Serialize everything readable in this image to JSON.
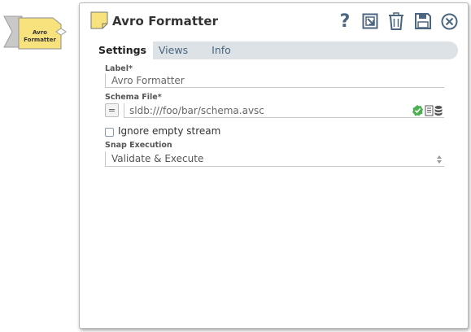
{
  "canvas": {
    "snap_label_line1": "Avro",
    "snap_label_line2": "Formatter",
    "snap_color": "#f7e27d"
  },
  "dialog": {
    "title": "Avro Formatter",
    "toolbar": {
      "help_icon": "question-mark-icon",
      "export_icon": "export-icon",
      "delete_icon": "trash-icon",
      "save_icon": "floppy-disk-icon",
      "close_icon": "circle-x-icon"
    },
    "tabs": [
      {
        "label": "Settings",
        "active": true
      },
      {
        "label": "Views",
        "active": false
      },
      {
        "label": "Info",
        "active": false
      }
    ],
    "fields": {
      "label_title": "Label*",
      "label_value": "Avro Formatter",
      "schema_title": "Schema File*",
      "schema_expr_toggle": "=",
      "schema_value": "sldb:///foo/bar/schema.avsc",
      "ignore_empty_label": "Ignore empty stream",
      "ignore_empty_checked": false,
      "snap_execution_title": "Snap Execution",
      "snap_execution_value": "Validate & Execute"
    }
  },
  "colors": {
    "accent": "#4d6680",
    "tab_bar": "#dde2e6",
    "valid_check": "#4caf50"
  }
}
